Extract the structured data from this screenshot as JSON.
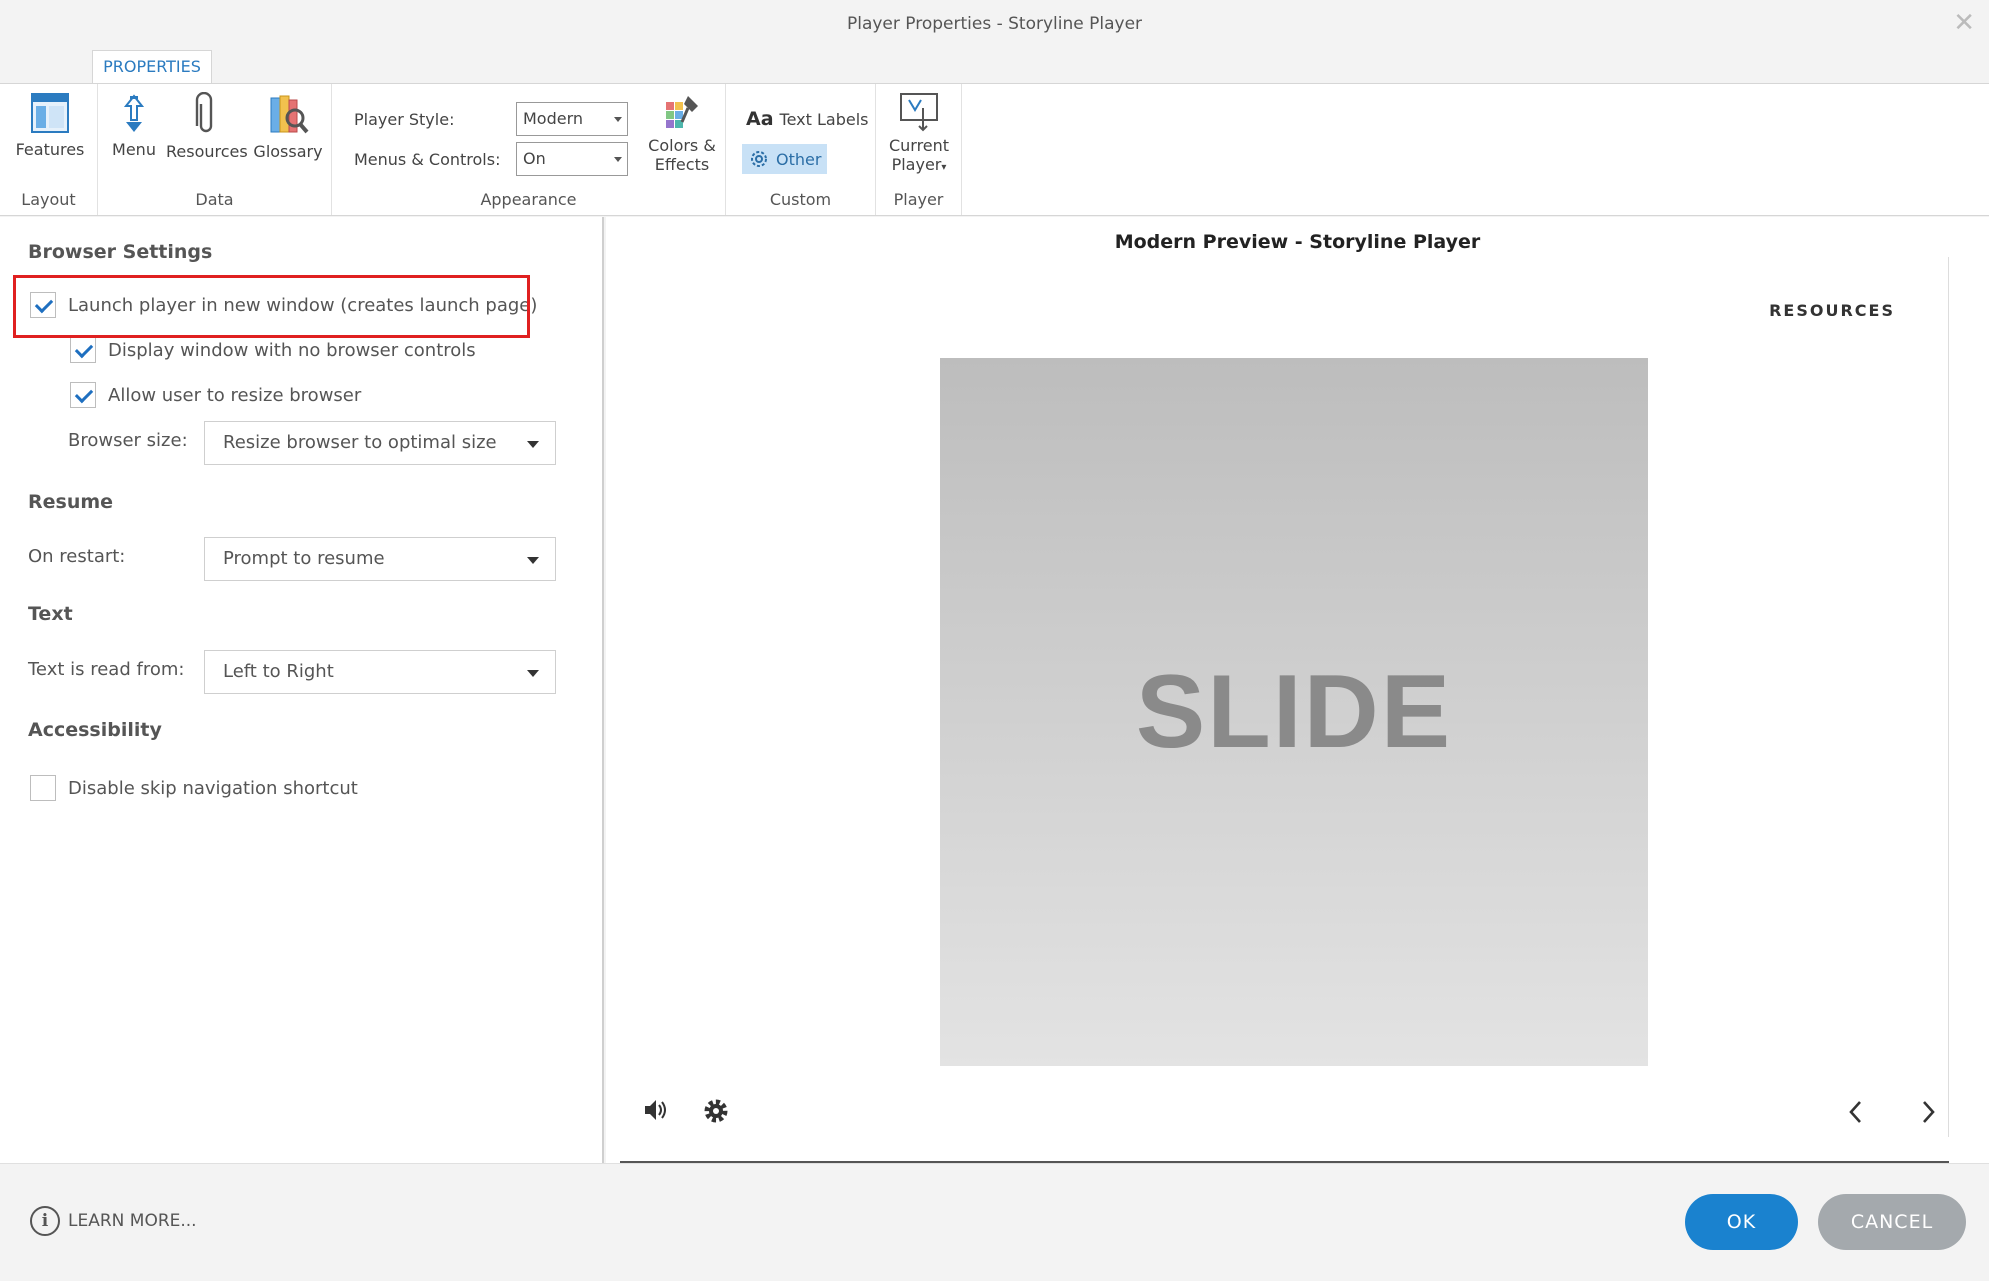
{
  "window": {
    "title": "Player Properties - Storyline Player"
  },
  "ribbon": {
    "tab": "PROPERTIES",
    "groups": {
      "layout": {
        "label": "Layout",
        "features": "Features"
      },
      "data": {
        "label": "Data",
        "menu": "Menu",
        "resources": "Resources",
        "glossary": "Glossary"
      },
      "appearance": {
        "label": "Appearance",
        "player_style_label": "Player Style:",
        "player_style_value": "Modern",
        "menus_controls_label": "Menus & Controls:",
        "menus_controls_value": "On",
        "colors_effects_1": "Colors &",
        "colors_effects_2": "Effects"
      },
      "custom": {
        "label": "Custom",
        "text_labels": "Text Labels",
        "text_labels_glyph": "Aa",
        "other": "Other"
      },
      "player": {
        "label": "Player",
        "current_1": "Current",
        "current_2": "Player"
      }
    }
  },
  "settings": {
    "browser_settings": {
      "heading": "Browser Settings",
      "launch_new_window": {
        "label": "Launch player in new window (creates launch page)",
        "checked": true
      },
      "no_browser_controls": {
        "label": "Display window with no browser controls",
        "checked": true
      },
      "allow_resize": {
        "label": "Allow user to resize browser",
        "checked": true
      },
      "browser_size_label": "Browser size:",
      "browser_size_value": "Resize browser to optimal size"
    },
    "resume": {
      "heading": "Resume",
      "on_restart_label": "On restart:",
      "on_restart_value": "Prompt to resume"
    },
    "text": {
      "heading": "Text",
      "read_from_label": "Text is read from:",
      "read_from_value": "Left to Right"
    },
    "accessibility": {
      "heading": "Accessibility",
      "disable_skip": {
        "label": "Disable skip navigation shortcut",
        "checked": false
      }
    }
  },
  "preview": {
    "title": "Modern Preview - Storyline Player",
    "resources": "RESOURCES",
    "slide_text": "SLIDE"
  },
  "footer": {
    "learn_more": "LEARN MORE...",
    "ok": "OK",
    "cancel": "CANCEL"
  },
  "colors": {
    "accent": "#1a82cf",
    "highlight": "#e02020",
    "cancel": "#a4a9ad"
  }
}
